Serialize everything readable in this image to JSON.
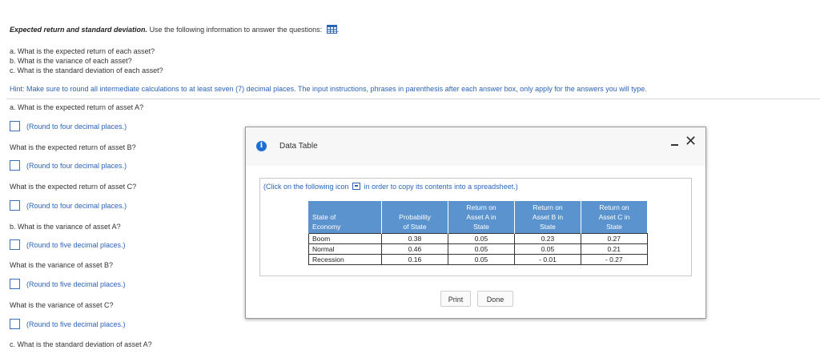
{
  "header": {
    "title_bold": "Expected return and standard deviation.",
    "title_rest": "Use the following information to answer the questions:",
    "table_icon": "table-grid-icon",
    "period": "."
  },
  "questions": [
    "a. What is the expected return of each asset?",
    "b. What is the variance of each asset?",
    "c. What is the standard deviation of each asset?"
  ],
  "hint": "Hint: Make sure to round all intermediate calculations to at least seven (7) decimal places. The input instructions, phrases in parenthesis after each answer box, only apply for the answers you will type.",
  "parts": {
    "q_a_A": "a. What is the expected return of asset A?",
    "ans_a_A": "(Round to four decimal places.)",
    "q_a_B": "What is the expected return of asset B?",
    "ans_a_B": "(Round to four decimal places.)",
    "q_a_C": "What is the expected return of asset C?",
    "ans_a_C": "(Round to four decimal places.)",
    "q_b_A": "b. What is the variance of asset A?",
    "ans_b_A": "(Round to five decimal places.)",
    "q_b_B": "What is the variance of asset B?",
    "ans_b_B": "(Round to five decimal places.)",
    "q_b_C": "What is the variance of asset C?",
    "ans_b_C": "(Round to five decimal places.)",
    "q_c_A": "c. What is the standard deviation of asset A?"
  },
  "modal": {
    "title": "Data Table",
    "info_icon": "info-icon",
    "info_glyph": "i",
    "minimize_icon": "minimize-icon",
    "close_glyph": "✕",
    "copy_text_before": "(Click on the following icon",
    "copy_text_after": "in order to copy its contents into a spreadsheet.)",
    "print_label": "Print",
    "done_label": "Done",
    "table": {
      "headers": [
        [
          "State of",
          "Economy"
        ],
        [
          "Probability",
          "of State"
        ],
        [
          "Return on",
          "Asset A in",
          "State"
        ],
        [
          "Return on",
          "Asset B in",
          "State"
        ],
        [
          "Return on",
          "Asset C in",
          "State"
        ]
      ],
      "rows": [
        [
          "Boom",
          "0.38",
          "0.05",
          "0.23",
          "0.27"
        ],
        [
          "Normal",
          "0.46",
          "0.05",
          "0.05",
          "0.21"
        ],
        [
          "Recession",
          "0.16",
          "0.05",
          "- 0.01",
          "- 0.27"
        ]
      ]
    }
  },
  "colors": {
    "link_blue": "#2b64b7",
    "table_header": "#5b93cf",
    "info_icon": "#1f6fd1"
  }
}
